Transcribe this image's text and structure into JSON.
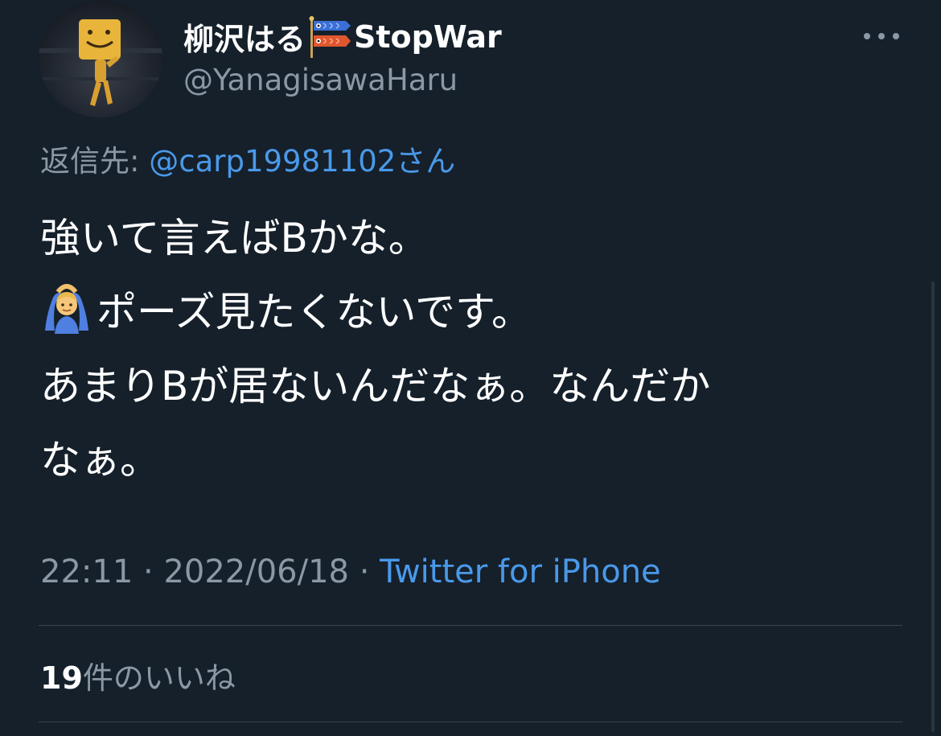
{
  "tweet": {
    "author": {
      "name_before_flag": "柳沢はる",
      "name_after_flag": "StopWar",
      "handle": "@YanagisawaHaru",
      "flag_icon": "carp-streamer-icon"
    },
    "reply": {
      "prefix": "返信先: ",
      "user": "@carp19981102",
      "suffix": "さん"
    },
    "text_lines": {
      "line1": "強いて言えばBかな。",
      "line2": "ポーズ見たくないです。",
      "line3": "あまりBが居ないんだなぁ。なんだか",
      "line4": "なぁ。"
    },
    "line2_emoji": "person-gesturing-ok-icon",
    "meta": {
      "time": "22:11",
      "sep1": " · ",
      "date": "2022/06/18",
      "sep2": " · ",
      "source": "Twitter for iPhone"
    },
    "likes": {
      "count": "19",
      "label": "件のいいね"
    },
    "menu_icon": "more-horizontal-icon"
  },
  "colors": {
    "background": "#15202b",
    "text": "#ffffff",
    "secondary": "#8b98a5",
    "link": "#4a99e9",
    "divider": "#38444d"
  }
}
